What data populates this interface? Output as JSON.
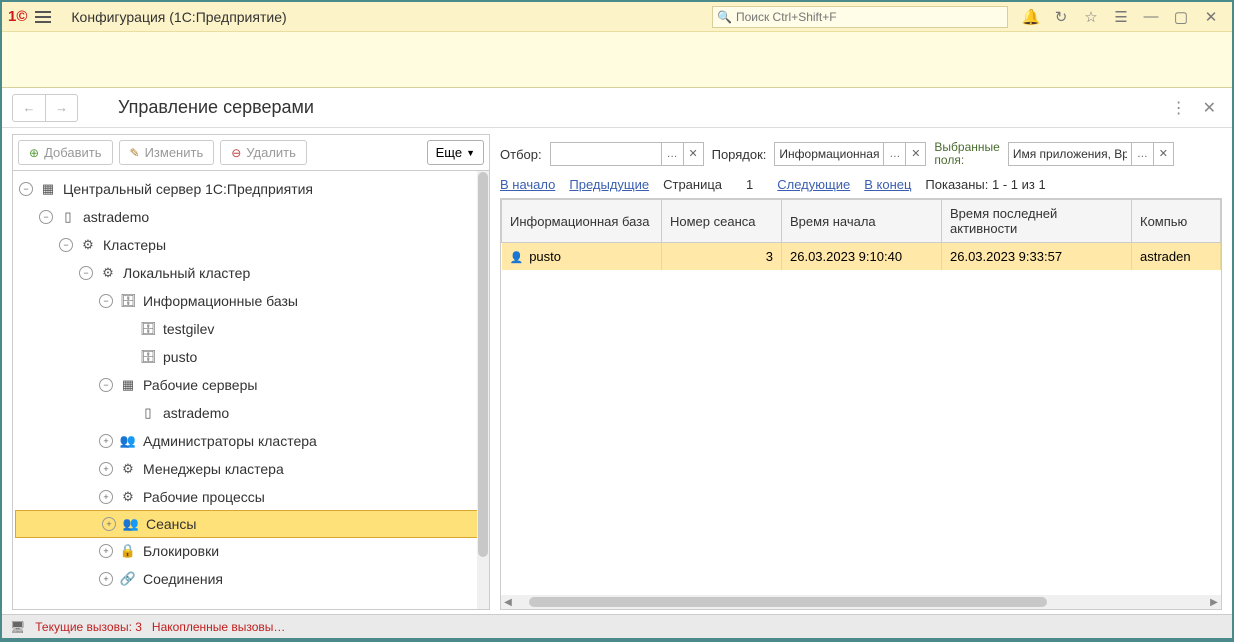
{
  "titlebar": {
    "title": "Конфигурация  (1С:Предприятие)",
    "search_placeholder": "Поиск Ctrl+Shift+F"
  },
  "subheader": {
    "title": "Управление серверами"
  },
  "toolbar": {
    "add": "Добавить",
    "edit": "Изменить",
    "delete": "Удалить",
    "more": "Еще"
  },
  "tree": {
    "root": "Центральный сервер 1С:Предприятия",
    "server": "astrademo",
    "clusters": "Кластеры",
    "local_cluster": "Локальный кластер",
    "infobases": "Информационные базы",
    "ib1": "testgilev",
    "ib2": "pusto",
    "work_servers": "Рабочие серверы",
    "ws1": "astrademo",
    "admins": "Администраторы кластера",
    "managers": "Менеджеры кластера",
    "processes": "Рабочие процессы",
    "sessions": "Сеансы",
    "locks": "Блокировки",
    "connections": "Соединения"
  },
  "filter": {
    "otbor": "Отбор:",
    "order": "Порядок:",
    "order_val": "Информационная б",
    "fields_lbl1": "Выбранные",
    "fields_lbl2": "поля:",
    "fields_val": "Имя приложения, Вре"
  },
  "pager": {
    "start": "В начало",
    "prev": "Предыдущие",
    "page": "Страница",
    "num": "1",
    "next": "Следующие",
    "end": "В конец",
    "shown": "Показаны: 1 - 1 из 1"
  },
  "table": {
    "h1": "Информационная база",
    "h2": "Номер сеанса",
    "h3": "Время начала",
    "h4": "Время последней активности",
    "h5": "Компью",
    "r1c1": "pusto",
    "r1c2": "3",
    "r1c3": "26.03.2023 9:10:40",
    "r1c4": "26.03.2023 9:33:57",
    "r1c5": "astraden"
  },
  "status": {
    "calls": "Текущие вызовы: 3",
    "acc": "Накопленные вызовы…"
  }
}
